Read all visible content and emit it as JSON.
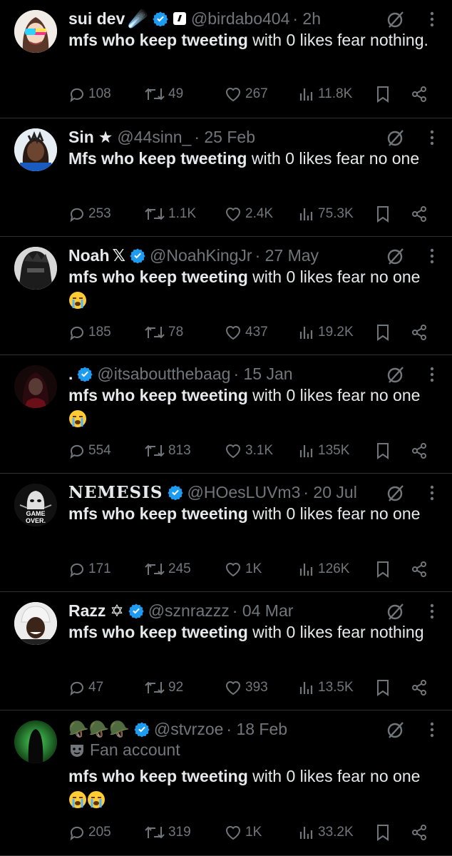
{
  "tweets": [
    {
      "name": "sui dev",
      "name_suffix": "☄️",
      "handle": "@birdabo404",
      "time": "· 2h",
      "bold": "mfs who keep tweeting",
      "rest": " with 0 likes fear nothing.",
      "emojis": 0,
      "replies": "108",
      "retweets": "49",
      "likes": "267",
      "views": "11.8K"
    },
    {
      "name": "Sin",
      "name_suffix": "★",
      "handle": "@44sinn_",
      "time": "· 25 Feb",
      "bold": "Mfs who keep tweeting",
      "rest": " with 0 likes fear no one",
      "emojis": 0,
      "replies": "253",
      "retweets": "1.1K",
      "likes": "2.4K",
      "views": "75.3K"
    },
    {
      "name": "Noah",
      "name_suffix": "𝕏",
      "handle": "@NoahKingJr",
      "time": "· 27 May",
      "bold": "mfs who keep tweeting",
      "rest": " with 0 likes fear no one ",
      "emojis": 1,
      "replies": "185",
      "retweets": "78",
      "likes": "437",
      "views": "19.2K"
    },
    {
      "name": ".",
      "name_suffix": "",
      "handle": "@itsaboutthebaag",
      "time": "· 15 Jan",
      "bold": "mfs who keep tweeting",
      "rest": " with 0 likes fear no one ",
      "emojis": 1,
      "replies": "554",
      "retweets": "813",
      "likes": "3.1K",
      "views": "135K"
    },
    {
      "name": "NEMESIS",
      "name_suffix": "",
      "handle": "@HOesLUVm3",
      "time": "· 20 Jul",
      "bold": "mfs who keep tweeting",
      "rest": " with 0 likes fear no one",
      "emojis": 0,
      "replies": "171",
      "retweets": "245",
      "likes": "1K",
      "views": "126K"
    },
    {
      "name": "Razz",
      "name_suffix": "✡",
      "handle": "@sznrazzz",
      "time": "· 04 Mar",
      "bold": "mfs who keep tweeting",
      "rest": " with 0 likes fear nothing",
      "emojis": 0,
      "replies": "47",
      "retweets": "92",
      "likes": "393",
      "views": "13.5K"
    },
    {
      "name": "🪖🪖🪖",
      "name_suffix": "",
      "handle": "@stvrzoe",
      "time": "· 18 Feb",
      "sub_label": "Fan account",
      "bold": "mfs who keep tweeting",
      "rest": " with 0 likes fear no one ",
      "emojis": 2,
      "replies": "205",
      "retweets": "319",
      "likes": "1K",
      "views": "33.2K"
    }
  ],
  "avatar_text": {
    "nemesis": "GAME OVER."
  },
  "colors": {
    "background": "#000000",
    "text": "#e7e9ea",
    "muted": "#71767b",
    "verified": "#1d9bf0",
    "divider": "#2f3336"
  },
  "icons": [
    "reply-icon",
    "retweet-icon",
    "like-icon",
    "views-icon",
    "bookmark-icon",
    "share-icon",
    "grok-icon",
    "more-icon",
    "verified-badge-icon",
    "crying-emoji-icon"
  ]
}
